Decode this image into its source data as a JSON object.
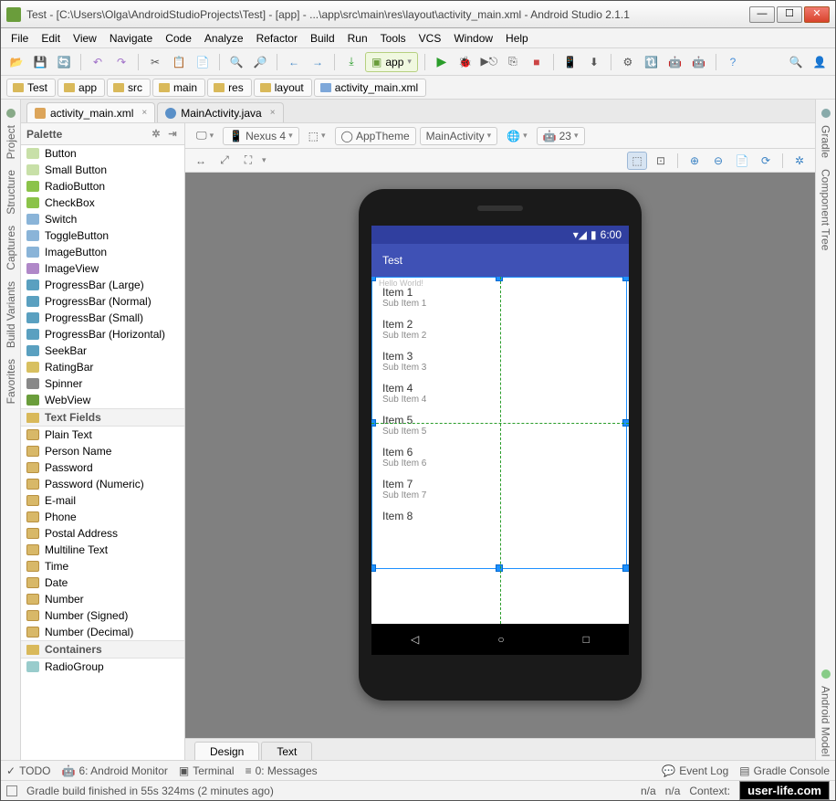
{
  "window": {
    "title": "Test - [C:\\Users\\Olga\\AndroidStudioProjects\\Test] - [app] - ...\\app\\src\\main\\res\\layout\\activity_main.xml - Android Studio 2.1.1"
  },
  "menu": [
    "File",
    "Edit",
    "View",
    "Navigate",
    "Code",
    "Analyze",
    "Refactor",
    "Build",
    "Run",
    "Tools",
    "VCS",
    "Window",
    "Help"
  ],
  "toolbar": {
    "app_selector": "app"
  },
  "breadcrumb": [
    "Test",
    "app",
    "src",
    "main",
    "res",
    "layout",
    "activity_main.xml"
  ],
  "editor_tabs": [
    {
      "label": "activity_main.xml",
      "type": "xml",
      "active": true
    },
    {
      "label": "MainActivity.java",
      "type": "java",
      "active": false
    }
  ],
  "left_tabs": [
    "Project",
    "Structure",
    "Captures",
    "Build Variants",
    "Favorites"
  ],
  "right_tabs": [
    "Gradle",
    "Component Tree",
    "Android Model"
  ],
  "palette": {
    "title": "Palette",
    "widgets": [
      "Button",
      "Small Button",
      "RadioButton",
      "CheckBox",
      "Switch",
      "ToggleButton",
      "ImageButton",
      "ImageView",
      "ProgressBar (Large)",
      "ProgressBar (Normal)",
      "ProgressBar (Small)",
      "ProgressBar (Horizontal)",
      "SeekBar",
      "RatingBar",
      "Spinner",
      "WebView"
    ],
    "text_fields_label": "Text Fields",
    "text_fields": [
      "Plain Text",
      "Person Name",
      "Password",
      "Password (Numeric)",
      "E-mail",
      "Phone",
      "Postal Address",
      "Multiline Text",
      "Time",
      "Date",
      "Number",
      "Number (Signed)",
      "Number (Decimal)"
    ],
    "containers_label": "Containers",
    "containers": [
      "RadioGroup"
    ]
  },
  "design_toolbar": {
    "device": "Nexus 4",
    "theme": "AppTheme",
    "activity": "MainActivity",
    "api": "23"
  },
  "preview": {
    "status_time": "6:00",
    "app_title": "Test",
    "hello": "Hello World!",
    "items": [
      {
        "t": "Item 1",
        "s": "Sub Item 1"
      },
      {
        "t": "Item 2",
        "s": "Sub Item 2"
      },
      {
        "t": "Item 3",
        "s": "Sub Item 3"
      },
      {
        "t": "Item 4",
        "s": "Sub Item 4"
      },
      {
        "t": "Item 5",
        "s": "Sub Item 5"
      },
      {
        "t": "Item 6",
        "s": "Sub Item 6"
      },
      {
        "t": "Item 7",
        "s": "Sub Item 7"
      },
      {
        "t": "Item 8",
        "s": ""
      }
    ]
  },
  "design_tabs": [
    "Design",
    "Text"
  ],
  "bottom_tools": {
    "todo": "TODO",
    "android_monitor": "6: Android Monitor",
    "terminal": "Terminal",
    "messages": "0: Messages",
    "event_log": "Event Log",
    "gradle_console": "Gradle Console"
  },
  "status": {
    "msg": "Gradle build finished in 55s 324ms (2 minutes ago)",
    "na1": "n/a",
    "na2": "n/a",
    "context": "Context:",
    "watermark": "user-life.com"
  }
}
